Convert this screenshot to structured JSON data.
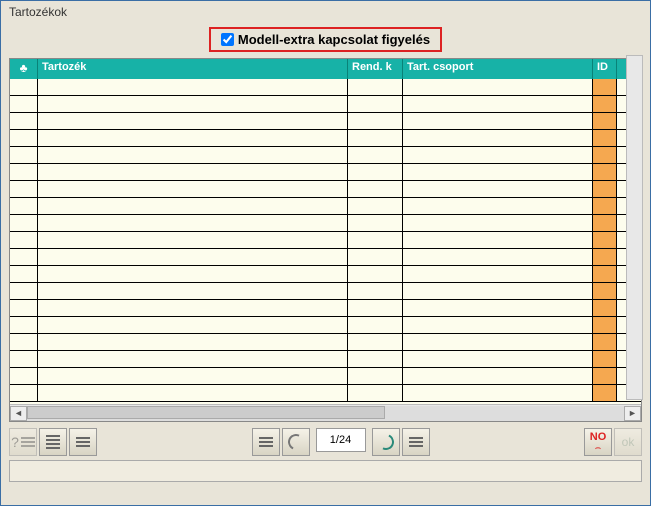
{
  "window": {
    "title": "Tartozékok"
  },
  "checkbox": {
    "label": "Modell-extra kapcsolat figyelés",
    "checked": true
  },
  "columns": {
    "icon": "♣",
    "tartozek": "Tartozék",
    "rend": "Rend. k",
    "csoport": "Tart. csoport",
    "id": "ID"
  },
  "rows": [
    {},
    {},
    {},
    {},
    {},
    {},
    {},
    {},
    {},
    {},
    {},
    {},
    {},
    {},
    {},
    {},
    {},
    {},
    {}
  ],
  "pager": {
    "label": "1/24"
  },
  "buttons": {
    "help": "?",
    "no": "NO",
    "ok": "ok"
  }
}
